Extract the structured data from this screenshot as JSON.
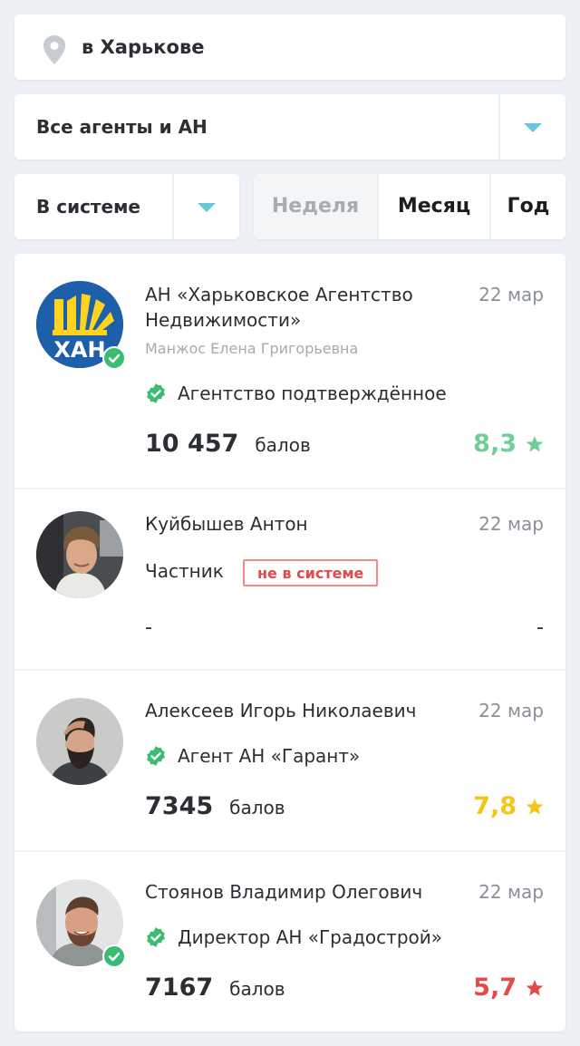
{
  "location": {
    "icon": "map-pin-icon",
    "text": "в Харькове"
  },
  "agent_filter": {
    "selected": "Все агенты и АН",
    "icon": "chevron-down-icon"
  },
  "status_filter": {
    "selected": "В системе",
    "icon": "chevron-down-icon"
  },
  "periods": [
    {
      "label": "Неделя",
      "active": true
    },
    {
      "label": "Месяц",
      "active": false
    },
    {
      "label": "Год",
      "active": false
    }
  ],
  "colors": {
    "accent": "#66c7d8",
    "verified": "#3dba73",
    "rating_high": "#6fcf97",
    "rating_mid": "#f5c518",
    "rating_low": "#e34b4b"
  },
  "agents": [
    {
      "name_line1": "АН «Харьковское Агентство",
      "name_line2": "Недвижимости»",
      "contact": "Манжос Елена Григорьевна",
      "date": "22 мар",
      "role": "Агентство подтверждённое",
      "score": "10 457",
      "score_unit": "балов",
      "rating": "8,3",
      "rating_color": "#6fcf97",
      "verified": true,
      "avatar": "xan-logo"
    },
    {
      "name": "Куйбышев Антон",
      "date": "22 мар",
      "role": "Частник",
      "status_badge": "не в системе",
      "score": "-",
      "rating": "-"
    },
    {
      "name": "Алексеев Игорь Николаевич",
      "date": "22 мар",
      "role": "Агент АН «Гарант»",
      "score": "7345",
      "score_unit": "балов",
      "rating": "7,8",
      "rating_color": "#f5c518"
    },
    {
      "name": "Стоянов Владимир Олегович",
      "date": "22 мар",
      "role": "Директор АН «Градострой»",
      "score": "7167",
      "score_unit": "балов",
      "rating": "5,7",
      "rating_color": "#e34b4b",
      "verified": true
    }
  ]
}
